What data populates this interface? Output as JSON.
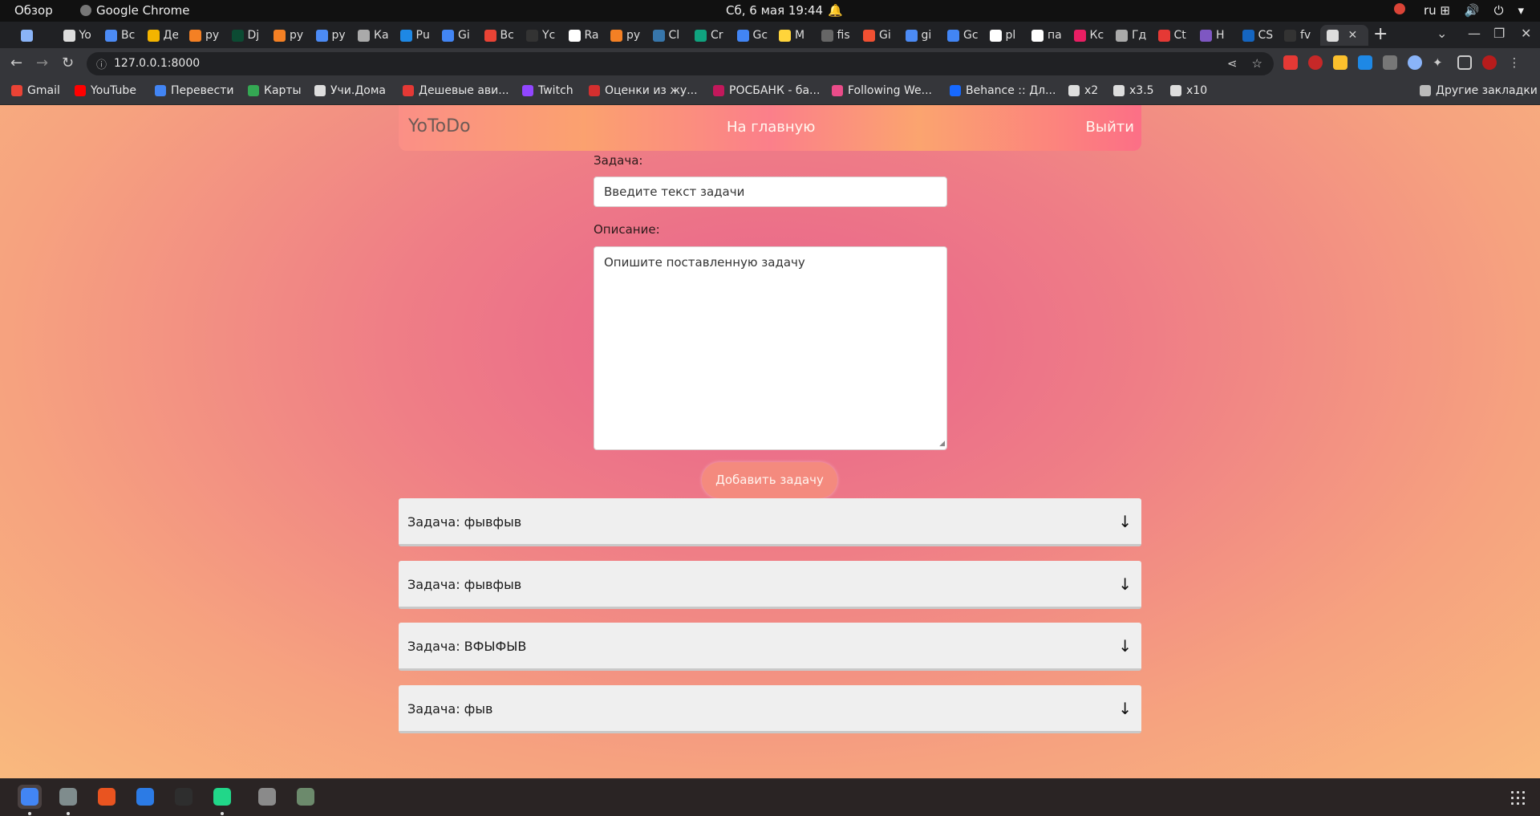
{
  "system": {
    "overview": "Обзор",
    "app_name": "Google Chrome",
    "clock": "Сб, 6 мая  19:44",
    "lang": "ru"
  },
  "tabs": [
    {
      "label": "",
      "color": "#8ab4f8"
    },
    {
      "label": "Yo",
      "color": "#dddddd"
    },
    {
      "label": "Вс",
      "color": "#4c8bf5"
    },
    {
      "label": "Де",
      "color": "#f4b400"
    },
    {
      "label": "ру",
      "color": "#f48024"
    },
    {
      "label": "Dj",
      "color": "#0c4b33"
    },
    {
      "label": "ру",
      "color": "#f48024"
    },
    {
      "label": "ру",
      "color": "#4c8bf5"
    },
    {
      "label": "Ка",
      "color": "#aaaaaa"
    },
    {
      "label": "Рu",
      "color": "#1e88e5"
    },
    {
      "label": "Gi",
      "color": "#4285f4"
    },
    {
      "label": "Вс",
      "color": "#ea4335"
    },
    {
      "label": "Yc",
      "color": "#333333"
    },
    {
      "label": "Ra",
      "color": "#ffffff"
    },
    {
      "label": "ру",
      "color": "#f48024"
    },
    {
      "label": "Cl",
      "color": "#3776ab"
    },
    {
      "label": "Cr",
      "color": "#10a37f"
    },
    {
      "label": "Gc",
      "color": "#4285f4"
    },
    {
      "label": "М",
      "color": "#ffd43b"
    },
    {
      "label": "fis",
      "color": "#666666"
    },
    {
      "label": "Gi",
      "color": "#f05032"
    },
    {
      "label": "gi",
      "color": "#4c8bf5"
    },
    {
      "label": "Gc",
      "color": "#4285f4"
    },
    {
      "label": "pl",
      "color": "#ffffff"
    },
    {
      "label": "па",
      "color": "#ffffff"
    },
    {
      "label": "Кс",
      "color": "#e91e63"
    },
    {
      "label": "Гд",
      "color": "#aaaaaa"
    },
    {
      "label": "Сt",
      "color": "#e53935"
    },
    {
      "label": "Н",
      "color": "#7e57c2"
    },
    {
      "label": "CS",
      "color": "#1565c0"
    },
    {
      "label": "fv",
      "color": "#333333"
    },
    {
      "label": "",
      "color": "#dddddd",
      "active": true
    }
  ],
  "toolbar": {
    "url": "127.0.0.1:8000"
  },
  "bookmarks": [
    {
      "label": "Gmail",
      "color": "#ea4335"
    },
    {
      "label": "YouTube",
      "color": "#ff0000"
    },
    {
      "label": "Перевести",
      "color": "#4285f4"
    },
    {
      "label": "Карты",
      "color": "#34a853"
    },
    {
      "label": "Учи.Дома",
      "color": "#dddddd"
    },
    {
      "label": "Дешевые ави...",
      "color": "#e53935"
    },
    {
      "label": "Twitch",
      "color": "#9146ff"
    },
    {
      "label": "Оценки из жу...",
      "color": "#d32f2f"
    },
    {
      "label": "РОСБАНК - ба...",
      "color": "#c2185b"
    },
    {
      "label": "Following We...",
      "color": "#ea4c89"
    },
    {
      "label": "Behance :: Дл...",
      "color": "#1769ff"
    },
    {
      "label": "x2",
      "color": "#dddddd"
    },
    {
      "label": "x3.5",
      "color": "#dddddd"
    },
    {
      "label": "x10",
      "color": "#dddddd"
    },
    {
      "label": "Другие закладки",
      "color": "#bbbbbb"
    }
  ],
  "page": {
    "brand": "YoToDo",
    "nav_home": "На главную",
    "nav_logout": "Выйти",
    "task_label": "Задача:",
    "task_placeholder": "Введите текст задачи",
    "desc_label": "Описание:",
    "desc_placeholder": "Опишите поставленную задачу",
    "add_button": "Добавить задачу",
    "tasks": [
      {
        "text": "Задача: фывфыв"
      },
      {
        "text": "Задача: фывфыв"
      },
      {
        "text": "Задача: ВФЫФЫВ"
      },
      {
        "text": "Задача: фыв"
      }
    ],
    "expand_arrow": "↓"
  },
  "colors": {
    "gradient_center": "#e8628c",
    "gradient_edge": "#f9b97e",
    "add_button": "#f48a7e",
    "task_card": "#efefef"
  },
  "dock": [
    {
      "name": "chrome-icon",
      "color": "#4285f4"
    },
    {
      "name": "files-icon",
      "color": "#7f8c8d"
    },
    {
      "name": "software-center-icon",
      "color": "#e95420"
    },
    {
      "name": "help-icon",
      "color": "#2c7be5"
    },
    {
      "name": "terminal-icon",
      "color": "#2e2e2e"
    },
    {
      "name": "pycharm-icon",
      "color": "#21d789"
    },
    {
      "name": "file-cabinet-icon",
      "color": "#8a8a8a"
    },
    {
      "name": "trash-icon",
      "color": "#6c8a6c"
    }
  ]
}
